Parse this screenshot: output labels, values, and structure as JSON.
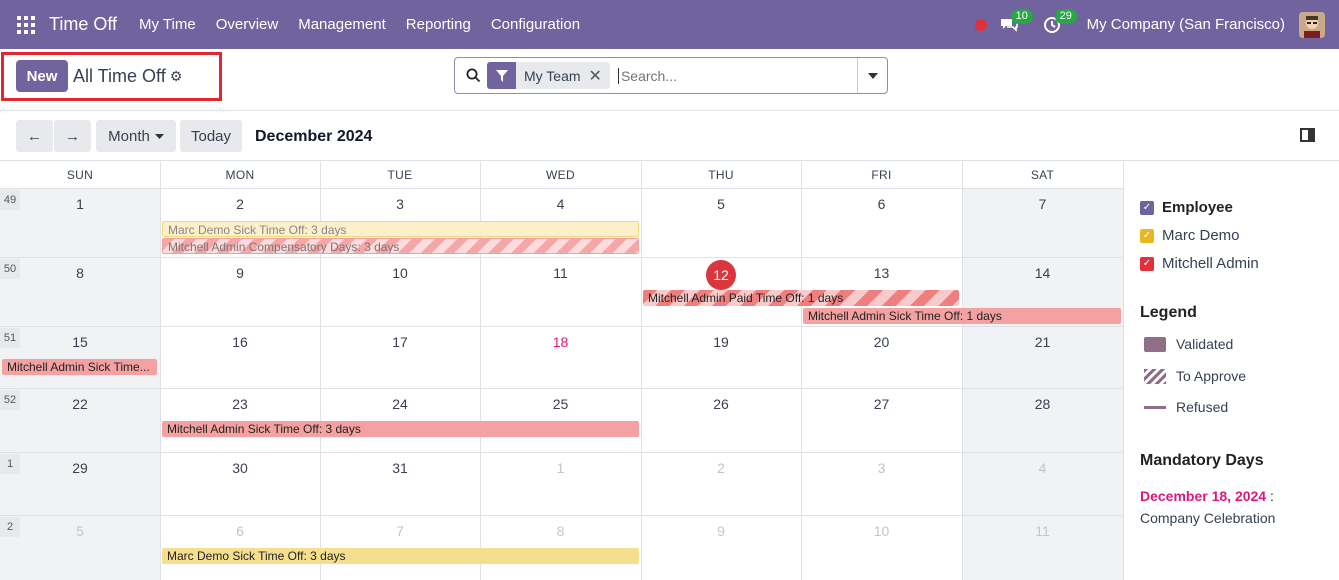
{
  "nav": {
    "app_title": "Time Off",
    "menu": [
      "My Time",
      "Overview",
      "Management",
      "Reporting",
      "Configuration"
    ],
    "messages_badge": "10",
    "activities_badge": "29",
    "company": "My Company (San Francisco)"
  },
  "control_panel": {
    "new_label": "New",
    "breadcrumb": "All Time Off",
    "facet_label": "My Team",
    "search_placeholder": "Search..."
  },
  "toolbar": {
    "prev": "←",
    "next": "→",
    "scale": "Month",
    "today": "Today",
    "period": "December 2024"
  },
  "calendar": {
    "days": [
      "SUN",
      "MON",
      "TUE",
      "WED",
      "THU",
      "FRI",
      "SAT"
    ],
    "today_date": "12",
    "weeks": [
      {
        "num": "49",
        "dates": [
          "1",
          "2",
          "3",
          "4",
          "5",
          "6",
          "7"
        ]
      },
      {
        "num": "50",
        "dates": [
          "8",
          "9",
          "10",
          "11",
          "12",
          "13",
          "14"
        ]
      },
      {
        "num": "51",
        "dates": [
          "15",
          "16",
          "17",
          "18",
          "19",
          "20",
          "21"
        ]
      },
      {
        "num": "52",
        "dates": [
          "22",
          "23",
          "24",
          "25",
          "26",
          "27",
          "28"
        ]
      },
      {
        "num": "1",
        "dates": [
          "29",
          "30",
          "31",
          "1",
          "2",
          "3",
          "4"
        ]
      },
      {
        "num": "2",
        "dates": [
          "5",
          "6",
          "7",
          "8",
          "9",
          "10",
          "11"
        ]
      }
    ],
    "events": [
      {
        "label": "Marc Demo Sick Time Off: 3 days",
        "week": 0,
        "start": 1,
        "span": 3
      },
      {
        "label": "Mitchell Admin Compensatory Days: 3 days",
        "week": 0,
        "start": 1,
        "span": 3
      },
      {
        "label": "Mitchell Admin Paid Time Off: 1 days",
        "week": 1,
        "start": 4,
        "span": 2
      },
      {
        "label": "Mitchell Admin Sick Time Off: 1 days",
        "week": 1,
        "start": 5,
        "span": 2
      },
      {
        "label": "Mitchell Admin Sick Time...",
        "week": 2,
        "start": 0,
        "span": 1
      },
      {
        "label": "Mitchell Admin Sick Time Off: 3 days",
        "week": 3,
        "start": 1,
        "span": 3
      },
      {
        "label": "Marc Demo Sick Time Off: 3 days",
        "week": 5,
        "start": 1,
        "span": 3
      }
    ]
  },
  "sidebar": {
    "filters": [
      {
        "label": "Employee",
        "color": "#71639e"
      },
      {
        "label": "Marc Demo",
        "color": "#e8b820"
      },
      {
        "label": "Mitchell Admin",
        "color": "#e0313a"
      }
    ],
    "legend_title": "Legend",
    "legend": [
      "Validated",
      "To Approve",
      "Refused"
    ],
    "mandatory_title": "Mandatory Days",
    "mandatory_date": "December 18, 2024",
    "mandatory_colon": ":",
    "mandatory_name": "Company Celebration"
  }
}
